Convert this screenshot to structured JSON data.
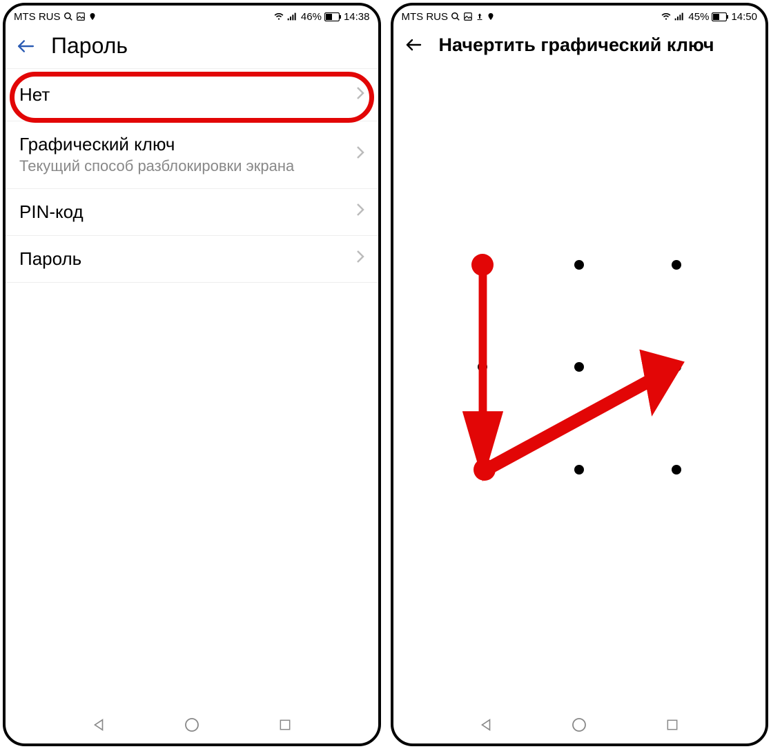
{
  "left": {
    "status": {
      "carrier": "MTS RUS",
      "battery_pct": "46%",
      "time": "14:38"
    },
    "header_title": "Пароль",
    "items": [
      {
        "label": "Нет",
        "sub": ""
      },
      {
        "label": "Графический ключ",
        "sub": "Текущий способ разблокировки экрана"
      },
      {
        "label": "PIN-код",
        "sub": ""
      },
      {
        "label": "Пароль",
        "sub": ""
      }
    ]
  },
  "right": {
    "status": {
      "carrier": "MTS RUS",
      "battery_pct": "45%",
      "time": "14:50"
    },
    "header_title": "Начертить графический ключ",
    "pattern": {
      "grid": "3x3",
      "path_nodes": [
        0,
        6,
        5
      ],
      "highlighted_nodes": [
        0,
        6
      ]
    }
  },
  "annotations": {
    "highlight_color": "#e20606"
  }
}
